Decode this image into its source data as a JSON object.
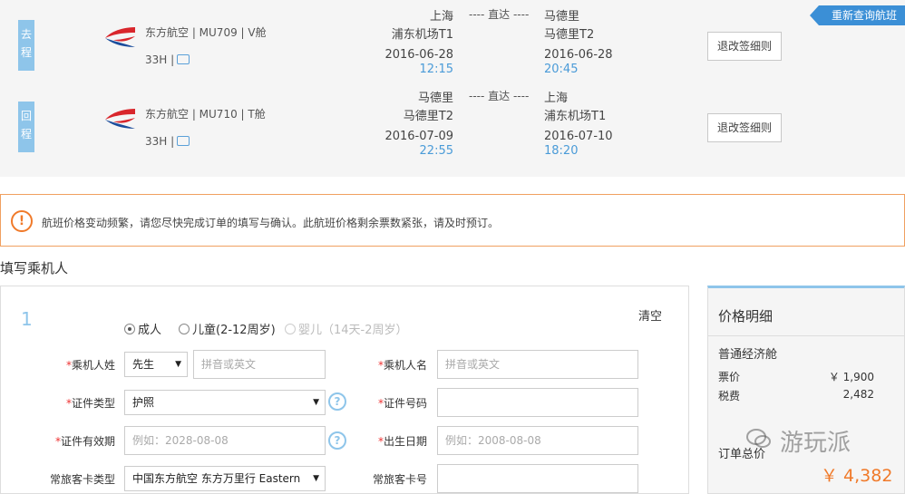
{
  "header": {
    "requery_label": "重新查询航班"
  },
  "legs": [
    {
      "tag": "去程",
      "airline_flight_cabin": "东方航空 | MU709 | V舱",
      "duration": "33H |",
      "dep_city": "上海",
      "dep_airport": "浦东机场T1",
      "dep_date": "2016-06-28",
      "dep_time": "12:15",
      "direct": "---- 直达 ----",
      "arr_city": "马德里",
      "arr_airport": "马德里T2",
      "arr_date": "2016-06-28",
      "arr_time": "20:45",
      "rules_label": "退改签细则"
    },
    {
      "tag": "回程",
      "airline_flight_cabin": "东方航空 | MU710 | T舱",
      "duration": "33H |",
      "dep_city": "马德里",
      "dep_airport": "马德里T2",
      "dep_date": "2016-07-09",
      "dep_time": "22:55",
      "direct": "---- 直达 ----",
      "arr_city": "上海",
      "arr_airport": "浦东机场T1",
      "arr_date": "2016-07-10",
      "arr_time": "18:20",
      "rules_label": "退改签细则"
    }
  ],
  "notice": {
    "icon": "exclamation-circle-icon",
    "text": "航班价格变动频繁，请您尽快完成订单的填写与确认。此航班价格剩余票数紧张，请及时预订。"
  },
  "passenger_section": {
    "title": "填写乘机人"
  },
  "passenger": {
    "index": "1",
    "clear_label": "清空",
    "types": [
      "成人",
      "儿童(2-12周岁)",
      "婴儿（14天-2周岁）"
    ],
    "selected_type": "成人",
    "fields": {
      "surname_label": "乘机人姓",
      "title_value": "先生",
      "surname_placeholder": "拼音或英文",
      "given_label": "乘机人名",
      "given_placeholder": "拼音或英文",
      "id_type_label": "证件类型",
      "id_type_value": "护照",
      "id_number_label": "证件号码",
      "id_expiry_label": "证件有效期",
      "id_expiry_placeholder": "例如：2028-08-08",
      "dob_label": "出生日期",
      "dob_placeholder": "例如：2008-08-08",
      "ffp_type_label": "常旅客卡类型",
      "ffp_type_value": "中国东方航空 东方万里行 Eastern",
      "ffp_number_label": "常旅客卡号"
    },
    "required_mark": "*",
    "help_glyph": "?"
  },
  "price_panel": {
    "title": "价格明细",
    "cabin": "普通经济舱",
    "fare_label": "票价",
    "fare_value": "￥ 1,900",
    "tax_label": "税费",
    "tax_value": "2,482",
    "total_label": "订单总价",
    "total_value": "￥ 4,382"
  },
  "watermark": {
    "text": "游玩派"
  },
  "colors": {
    "accent_blue": "#3b8fd6",
    "tag_blue": "#8ec5ea",
    "warning_orange": "#f07a2a",
    "airline_red": "#d9262c",
    "airline_blue": "#1b4d9c"
  }
}
